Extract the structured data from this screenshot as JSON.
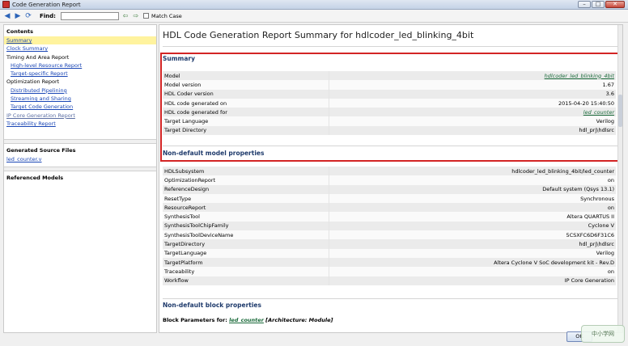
{
  "window": {
    "title": "Code Generation Report",
    "buttons": [
      "–",
      "□",
      "✕"
    ]
  },
  "toolbar": {
    "find_label": "Find:",
    "find_value": "",
    "match_case_label": "Match Case",
    "icons": [
      "back-icon",
      "forward-icon",
      "refresh-icon"
    ]
  },
  "toc": {
    "heading": "Contents",
    "items": [
      {
        "label": "Summary",
        "link": true,
        "indent": false,
        "selected": true
      },
      {
        "label": "Clock Summary",
        "link": true,
        "indent": false
      },
      {
        "label": "Timing And Area Report",
        "link": false,
        "indent": false
      },
      {
        "label": "High-level Resource Report",
        "link": true,
        "indent": true
      },
      {
        "label": "Target-specific Report",
        "link": true,
        "indent": true
      },
      {
        "label": "Optimization Report",
        "link": false,
        "indent": false
      },
      {
        "label": "Distributed Pipelining",
        "link": true,
        "indent": true
      },
      {
        "label": "Streaming and Sharing",
        "link": true,
        "indent": true
      },
      {
        "label": "Target Code Generation",
        "link": true,
        "indent": true
      },
      {
        "label": "IP Core Generation Report",
        "link": true,
        "indent": false,
        "dim": true
      },
      {
        "label": "Traceability Report",
        "link": true,
        "indent": false
      }
    ]
  },
  "generated_files": {
    "heading": "Generated Source Files",
    "files": [
      "led_counter.v"
    ]
  },
  "referenced_models": {
    "heading": "Referenced Models"
  },
  "report": {
    "title": "HDL Code Generation Report Summary for hdlcoder_led_blinking_4bit",
    "summary": {
      "heading": "Summary",
      "rows": [
        {
          "key": "Model",
          "value": "hdlcoder_led_blinking_4bit",
          "link": true
        },
        {
          "key": "Model version",
          "value": "1.67"
        },
        {
          "key": "HDL Coder version",
          "value": "3.6"
        },
        {
          "key": "HDL code generated on",
          "value": "2015-04-20 15:40:50"
        },
        {
          "key": "HDL code generated for",
          "value": "led_counter",
          "link": true
        },
        {
          "key": "Target Language",
          "value": "Verilog"
        },
        {
          "key": "Target Directory",
          "value": "hdl_prj\\hdlsrc"
        }
      ]
    },
    "model_props": {
      "heading": "Non-default model properties",
      "rows": [
        {
          "key": "HDLSubsystem",
          "value": "hdlcoder_led_blinking_4bit/led_counter"
        },
        {
          "key": "OptimizationReport",
          "value": "on"
        },
        {
          "key": "ReferenceDesign",
          "value": "Default system (Qsys 13.1)"
        },
        {
          "key": "ResetType",
          "value": "Synchronous"
        },
        {
          "key": "ResourceReport",
          "value": "on"
        },
        {
          "key": "SynthesisTool",
          "value": "Altera QUARTUS II"
        },
        {
          "key": "SynthesisToolChipFamily",
          "value": "Cyclone V"
        },
        {
          "key": "SynthesisToolDeviceName",
          "value": "5CSXFC6D6F31C6"
        },
        {
          "key": "TargetDirectory",
          "value": "hdl_prj\\hdlsrc"
        },
        {
          "key": "TargetLanguage",
          "value": "Verilog"
        },
        {
          "key": "TargetPlatform",
          "value": "Altera Cyclone V SoC development kit - Rev.D"
        },
        {
          "key": "Traceability",
          "value": "on"
        },
        {
          "key": "Workflow",
          "value": "IP Core Generation"
        }
      ]
    },
    "block_props": {
      "heading": "Non-default block properties",
      "params_prefix": "Block Parameters for:",
      "params_link": "led_counter",
      "params_arch": "[Architecture: Module]"
    }
  },
  "footer": {
    "ok_label": "OK",
    "watermark": "中小学网"
  }
}
